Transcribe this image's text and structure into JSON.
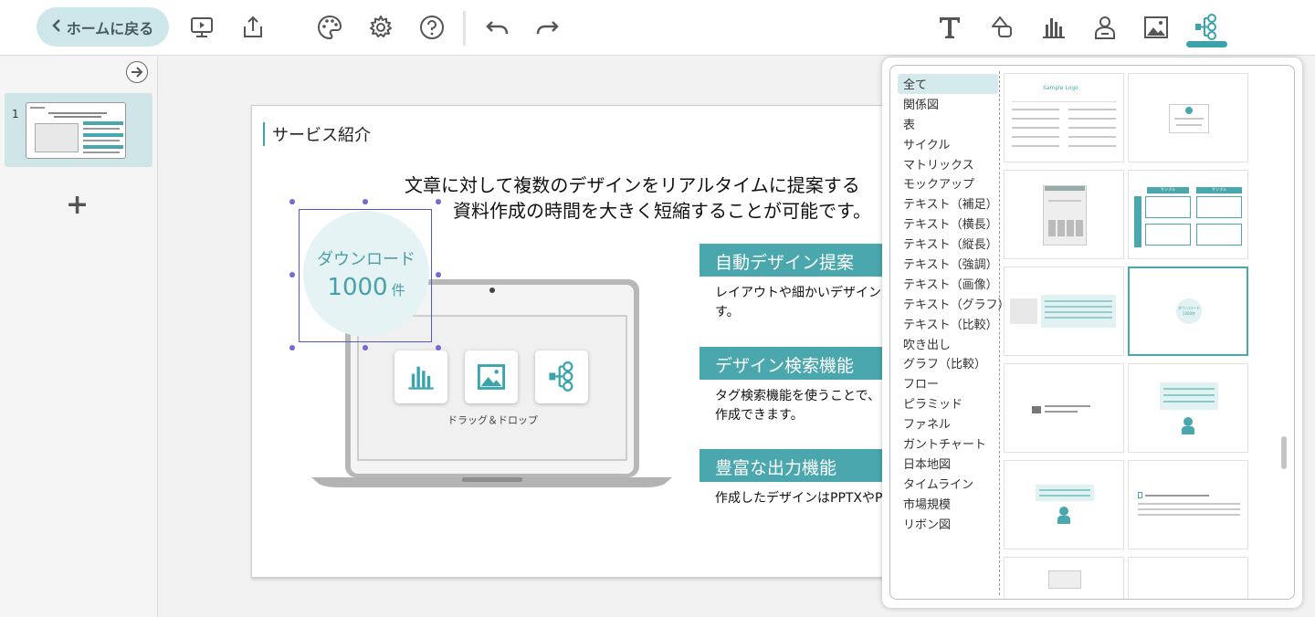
{
  "toolbar": {
    "home_label": "ホームに戻る",
    "accent": "#3aa4ad",
    "left_icons": [
      "play-slide-icon",
      "export-icon",
      "palette-icon",
      "gear-icon",
      "help-icon",
      "undo-icon",
      "redo-icon"
    ],
    "right_icons": [
      "text-tool-icon",
      "shape-tool-icon",
      "chart-tool-icon",
      "person-tool-icon",
      "image-tool-icon",
      "diagram-tool-icon"
    ],
    "active_tool": "diagram-tool-icon"
  },
  "sidebar": {
    "slides": [
      {
        "number": "1"
      }
    ],
    "add_label": "+"
  },
  "slide": {
    "title": "サービス紹介",
    "lead_line1": "文章に対して複数のデザインをリアルタイムに提案する",
    "lead_line2": "資料作成の時間を大きく短縮することが可能です。",
    "circle_label": "ダウンロード",
    "circle_value": "1000",
    "circle_unit": "件",
    "laptop_caption": "ドラッグ＆ドロップ",
    "features": [
      {
        "title": "自動デザイン提案",
        "text1": "レイアウトや細かいデザイン",
        "text2": "す。"
      },
      {
        "title": "デザイン検索機能",
        "text1": "タグ検索機能を使うことで、",
        "text2": "作成できます。"
      },
      {
        "title": "豊富な出力機能",
        "text1": "作成したデザインはPPTXやP",
        "text2": ""
      }
    ]
  },
  "panel": {
    "categories": [
      "全て",
      "関係図",
      "表",
      "サイクル",
      "マトリックス",
      "モックアップ",
      "テキスト（補足）",
      "テキスト（横長）",
      "テキスト（縦長）",
      "テキスト（強調）",
      "テキスト（画像）",
      "テキスト（グラフ）",
      "テキスト（比較）",
      "吹き出し",
      "グラフ（比較）",
      "フロー",
      "ピラミッド",
      "ファネル",
      "ガントチャート",
      "日本地図",
      "タイムライン",
      "市場規模",
      "リボン図"
    ],
    "active_category": "全て",
    "tpl_logo": "Sample Logo",
    "tpl_small_text": "サンプルテキスト",
    "tpl_sample": "サンプル",
    "tpl_download": "ダウンロード",
    "tpl_download_value": "1000件"
  }
}
